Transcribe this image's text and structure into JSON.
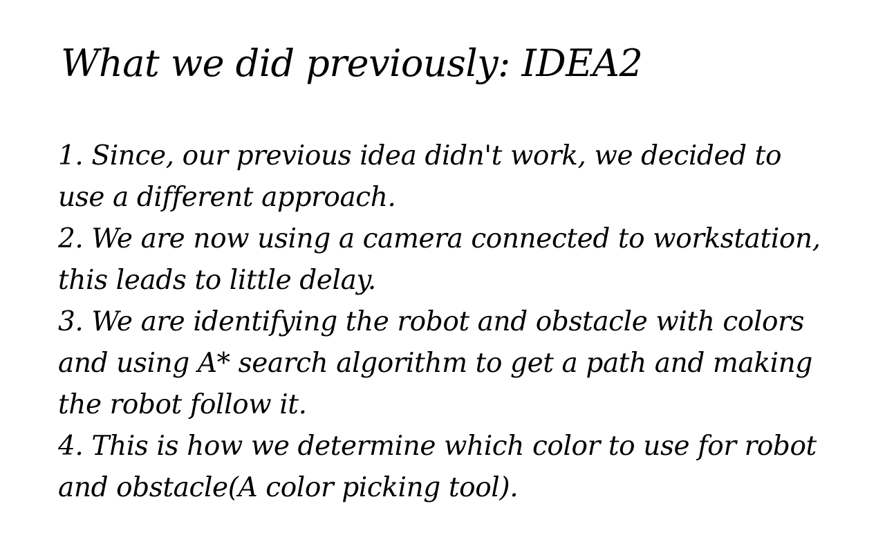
{
  "slide": {
    "title": "What we did previously: IDEA2",
    "points": [
      "1. Since, our previous idea didn't work, we decided to use a different approach.",
      "2. We are now using a camera connected to workstation, this leads to little delay.",
      "3. We are identifying the robot and obstacle with colors and using A* search algorithm to get a path and making the robot follow it.",
      "4. This is how we determine which color to use for robot and obstacle(A color picking tool)."
    ]
  }
}
